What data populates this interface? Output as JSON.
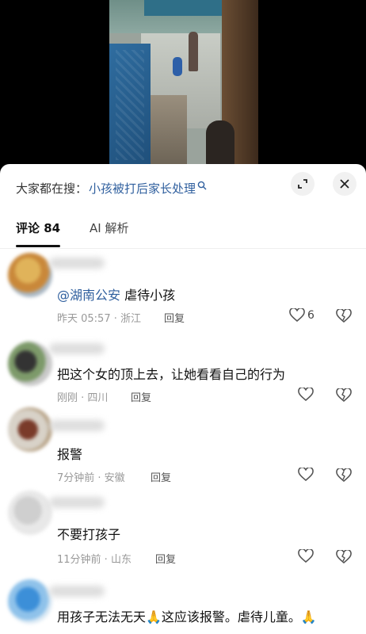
{
  "search": {
    "prefix": "大家都在搜：",
    "term": "小孩被打后家长处理"
  },
  "tabs": [
    {
      "label": "评论 84",
      "active": true
    },
    {
      "label": "AI 解析",
      "active": false
    }
  ],
  "comments": [
    {
      "text_mention": "@湖南公安",
      "text": " 虐待小孩",
      "time": "昨天 05:57 · 浙江",
      "reply": "回复",
      "likes": "6"
    },
    {
      "text": "把这个女的顶上去，让她看看自己的行为",
      "time": "刚刚 · 四川",
      "reply": "回复",
      "likes": ""
    },
    {
      "text": "报警",
      "time": "7分钟前 · 安徽",
      "reply": "回复",
      "likes": ""
    },
    {
      "text": "不要打孩子",
      "time": "11分钟前 · 山东",
      "reply": "回复",
      "likes": ""
    },
    {
      "text": "用孩子无法无天🙏这应该报警。虐待儿童。🙏",
      "time": "",
      "reply": "",
      "likes": ""
    }
  ],
  "colors": {
    "link": "#2f5f9e",
    "meta": "#999999"
  }
}
